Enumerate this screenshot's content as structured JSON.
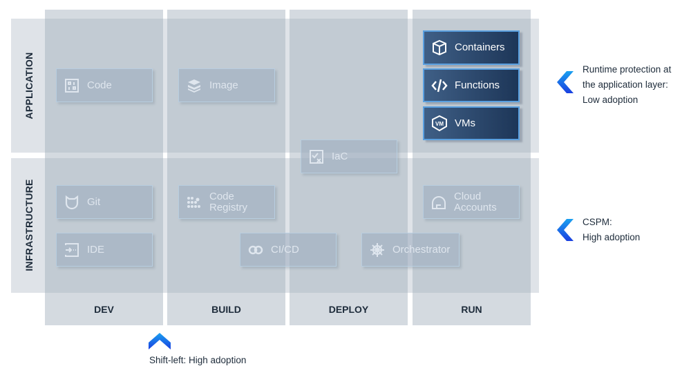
{
  "rows": [
    {
      "label": "APPLICATION"
    },
    {
      "label": "INFRASTRUCTURE"
    }
  ],
  "columns": [
    {
      "label": "DEV"
    },
    {
      "label": "BUILD"
    },
    {
      "label": "DEPLOY"
    },
    {
      "label": "RUN"
    }
  ],
  "tiles": {
    "code": {
      "label": "Code",
      "icon": "code-square-icon"
    },
    "image": {
      "label": "Image",
      "icon": "layers-icon"
    },
    "iac": {
      "label": "IaC",
      "icon": "checklist-icon"
    },
    "git": {
      "label": "Git",
      "icon": "git-cat-icon"
    },
    "registry": {
      "label1": "Code",
      "label2": "Registry",
      "icon": "dots-grid-icon"
    },
    "cloud": {
      "label1": "Cloud",
      "label2": "Accounts",
      "icon": "cloud-icon"
    },
    "ide": {
      "label": "IDE",
      "icon": "terminal-arrow-icon"
    },
    "cicd": {
      "label": "CI/CD",
      "icon": "loop-icon"
    },
    "orch": {
      "label": "Orchestrator",
      "icon": "helm-wheel-icon"
    },
    "containers": {
      "label": "Containers",
      "icon": "container-icon"
    },
    "functions": {
      "label": "Functions",
      "icon": "code-brackets-icon"
    },
    "vms": {
      "label": "VMs",
      "icon": "vm-icon"
    }
  },
  "notes": {
    "runtime": {
      "line1": "Runtime protection at",
      "line2": "the application layer:",
      "line3": "Low adoption"
    },
    "cspm": {
      "line1": "CSPM:",
      "line2": "High adoption"
    },
    "shift": {
      "line1": "Shift-left: High adoption"
    }
  },
  "colors": {
    "accent": "#1565e0",
    "highlight_tile": "#1d3658"
  }
}
